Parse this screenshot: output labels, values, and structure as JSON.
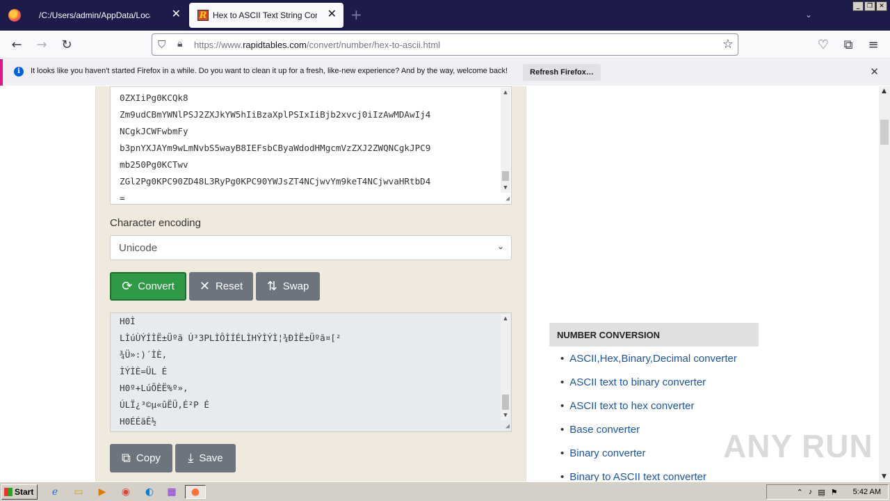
{
  "browser": {
    "tabs": [
      {
        "label": "/C:/Users/admin/AppData/Local/Temp/",
        "active": false
      },
      {
        "label": "Hex to ASCII Text String Converter",
        "active": true
      }
    ],
    "new_tab_symbol": "+",
    "url_prefix": "https://www.",
    "url_domain": "rapidtables.com",
    "url_path": "/convert/number/hex-to-ascii.html"
  },
  "notification": {
    "message": "It looks like you haven't started Firefox in a while. Do you want to clean it up for a fresh, like-new experience? And by the way, welcome back!",
    "button": "Refresh Firefox…"
  },
  "converter": {
    "input_lines": [
      "0ZXIiPg0KCQk8",
      "Zm9udCBmYWNlPSJ2ZXJkYW5hIiBzaXplPSIxIiBjb2xvcj0iIzAwMDAwIj4",
      "NCgkJCWFwbmFy",
      "b3pnYXJAYm9wLmNvbS5wayB8IEFsbCByaWdodHMgcmVzZXJ2ZWQNCgkJPC9",
      "mb250Pg0KCTwv",
      "ZGl2Pg0KPC90ZD48L3RyPg0KPC90YWJsZT4NCjwvYm9keT4NCjwvaHRtbD4",
      "="
    ],
    "encoding_label": "Character encoding",
    "encoding_value": "Unicode",
    "buttons": {
      "convert": "Convert",
      "reset": "Reset",
      "swap": "Swap",
      "copy": "Copy",
      "save": "Save"
    },
    "output_lines": [
      "H0Ì",
      "LÌúÙÝÍÌË±Üºã Ú³3PLÌÔÌÍÉLÌHÝÌÝÌ¦¾ÐÌË±Üºã¤[²",
      "¾Ü»:)´ÌÈ,",
      "ÌÝÌÈ=ÜL É",
      "H0º+LúÕÈË%º»,",
      "ÚLÏ¿³©µ«ûËÜ,É²P É",
      "H0ÉÉäÊ½"
    ]
  },
  "sidebar": {
    "heading": "NUMBER CONVERSION",
    "links": [
      "ASCII,Hex,Binary,Decimal converter",
      "ASCII text to binary converter",
      "ASCII text to hex converter",
      "Base converter",
      "Binary converter",
      "Binary to ASCII text converter"
    ]
  },
  "watermark": "ANY RUN",
  "taskbar": {
    "start_label": "Start",
    "clock": "5:42 AM"
  }
}
